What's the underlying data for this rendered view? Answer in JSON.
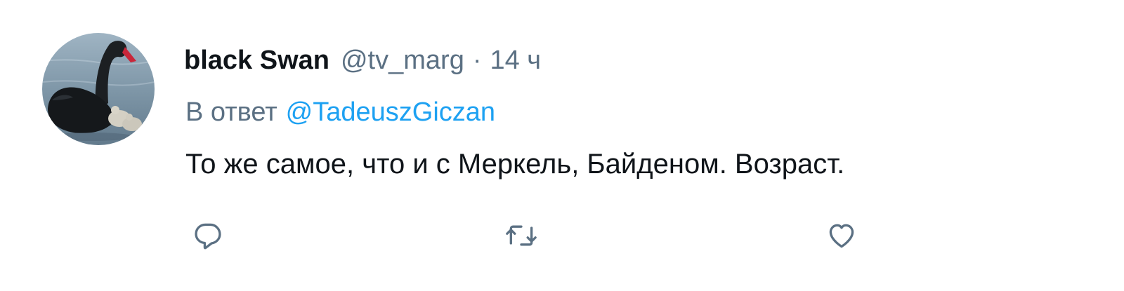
{
  "tweet": {
    "display_name": "black Swan",
    "handle": "@tv_marg",
    "separator": "·",
    "time": "14 ч",
    "reply_prefix": "В ответ",
    "reply_to": "@TadeuszGiczan",
    "text": "То же самое, что и с Меркель, Байденом. Возраст."
  },
  "avatar": {
    "description": "black-swan-photo"
  },
  "actions": {
    "reply_icon": "reply-icon",
    "retweet_icon": "retweet-icon",
    "like_icon": "heart-icon"
  },
  "colors": {
    "text_primary": "#0f1419",
    "text_secondary": "#5b7083",
    "link": "#1da1f2",
    "background": "#ffffff"
  }
}
